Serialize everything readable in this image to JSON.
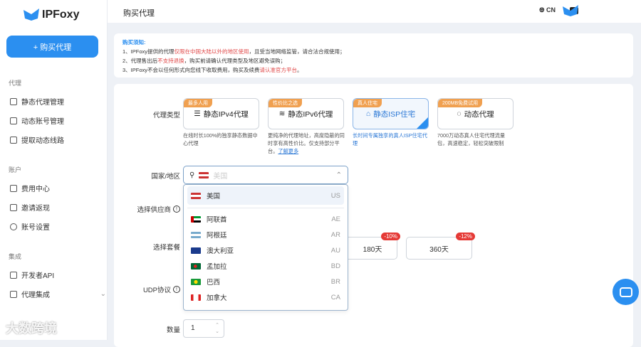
{
  "brand": {
    "name": "IPFoxy",
    "color": "#2b8ff0"
  },
  "sidebar": {
    "buy_button": "+ 购买代理",
    "sections": [
      {
        "title": "代理",
        "items": [
          "静态代理管理",
          "动态账号管理",
          "提取动态线路"
        ]
      },
      {
        "title": "账户",
        "items": [
          "费用中心",
          "邀请返现",
          "账号设置"
        ]
      },
      {
        "title": "集成",
        "items": [
          "开发者API",
          "代理集成"
        ]
      }
    ]
  },
  "header": {
    "title": "购买代理",
    "language": "CN"
  },
  "notice": {
    "heading": "购买须知:",
    "lines": [
      {
        "pre": "1、IPFoxy提供的代理",
        "red": "仅限在中国大陆以外的地区使用",
        "post": "，且受当地网络监管，请合法合规使用；"
      },
      {
        "pre": "2、代理售出后",
        "red": "不支持退换",
        "post": "，购买前请确认代理类型及地区避免误购；"
      },
      {
        "pre": "3、IPFoxy不会以任何形式向您线下收取费用，购买及续费",
        "red": "请认准官方平台",
        "post": "。"
      }
    ]
  },
  "form": {
    "proxy_type_label": "代理类型",
    "proxy_types": [
      {
        "badge": "最多人用",
        "name": "静态IPv4代理",
        "desc": "在线时长100%的独享静态数据中心代理",
        "selected": false
      },
      {
        "badge": "性价比之选",
        "name": "静态IPv6代理",
        "desc": "更纯净的代理地址，高度隐蔽的同时享有高性价比。仅支持部分平台。",
        "link": "了解更多",
        "selected": false
      },
      {
        "badge": "真人住宅",
        "name": "静态ISP住宅",
        "desc": "长时间专属独享的真人ISP住宅代理",
        "selected": true
      },
      {
        "badge": "200MB免费试用",
        "name": "动态代理",
        "desc": "7000万动态真人住宅代理流量包，高速稳定，轻松突破限制",
        "selected": false
      }
    ],
    "country_label": "国家/地区",
    "country_placeholder": "美国",
    "countries": [
      {
        "name": "美国",
        "code": "US"
      },
      {
        "name": "阿联酋",
        "code": "AE"
      },
      {
        "name": "阿根廷",
        "code": "AR"
      },
      {
        "name": "澳大利亚",
        "code": "AU"
      },
      {
        "name": "孟加拉",
        "code": "BD"
      },
      {
        "name": "巴西",
        "code": "BR"
      },
      {
        "name": "加拿大",
        "code": "CA"
      }
    ],
    "supplier_label": "选择供应商",
    "package_label": "选择套餐",
    "packages": [
      {
        "name": "180天",
        "discount": "-10%"
      },
      {
        "name": "360天",
        "discount": "-12%"
      }
    ],
    "udp_label": "UDP协议",
    "quantity_label": "数量",
    "quantity": "1"
  },
  "watermark": "大数跨境"
}
